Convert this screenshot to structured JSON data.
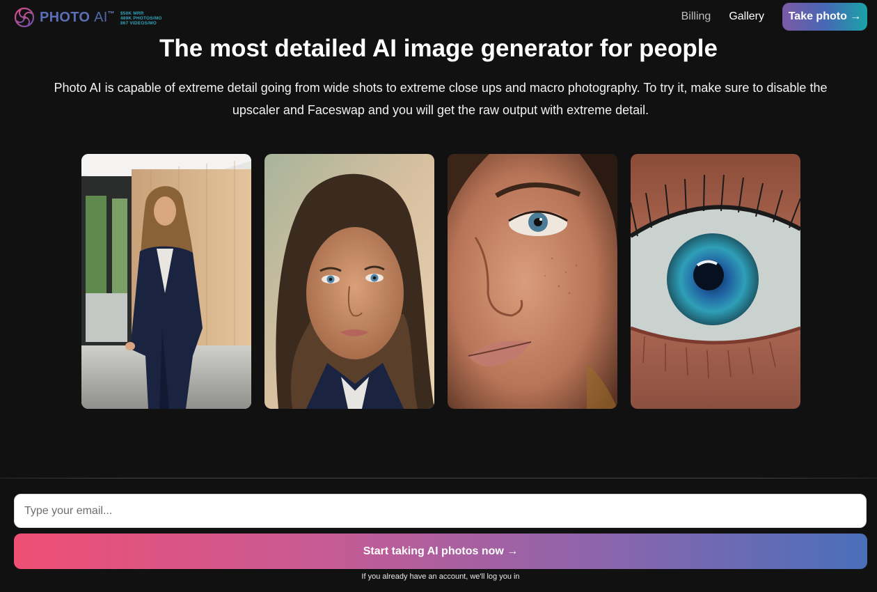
{
  "header": {
    "logo": {
      "brand": "PHOTO",
      "ai": "AI",
      "tm": "™",
      "stats": [
        "$50K MRR",
        "489K PHOTOS/MO",
        "867 VIDEOS/MO"
      ]
    },
    "nav": {
      "billing": "Billing",
      "gallery": "Gallery",
      "take_photo": "Take photo →"
    }
  },
  "hero": {
    "title": "The most detailed AI image generator for people",
    "description": "Photo AI is capable of extreme detail going from wide shots to extreme close ups and macro photography. To try it, make sure to disable the upscaler and Faceswap and you will get the raw output with extreme detail."
  },
  "gallery": {
    "images": [
      {
        "subject": "woman-in-navy-suit-wide-shot"
      },
      {
        "subject": "woman-portrait-close-up"
      },
      {
        "subject": "woman-face-extreme-close-up"
      },
      {
        "subject": "eye-macro-shot"
      }
    ]
  },
  "signup": {
    "email_placeholder": "Type your email...",
    "cta_label": "Start taking AI photos now →",
    "login_note": "If you already have an account, we'll log you in"
  },
  "colors": {
    "background": "#111111",
    "brand_blue": "#5b6fb8",
    "stats_teal": "#2fa3b8",
    "cta_gradient_start": "#ef4f74",
    "cta_gradient_end": "#4a6fba"
  }
}
